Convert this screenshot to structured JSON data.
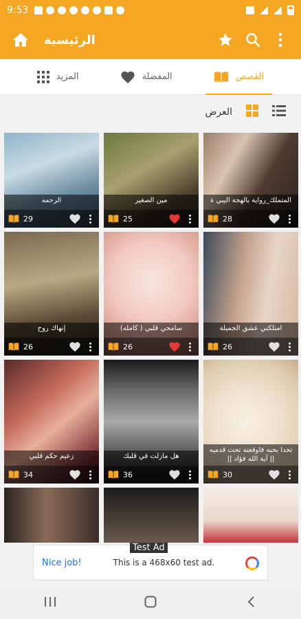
{
  "status": {
    "time": "9:53"
  },
  "toolbar": {
    "title": "الرئيسية"
  },
  "tabs": [
    {
      "label": "المزيد"
    },
    {
      "label": "المفضلة"
    },
    {
      "label": "القصص"
    }
  ],
  "view": {
    "label": "العرض"
  },
  "stories": [
    {
      "title": "الرحمه",
      "count": "29",
      "liked": false
    },
    {
      "title": "مين الصغير",
      "count": "25",
      "liked": true
    },
    {
      "title": "المتملك_رواية بالهجة اليبي ة",
      "count": "28",
      "liked": false
    },
    {
      "title": "إنهاك روح",
      "count": "26",
      "liked": false
    },
    {
      "title": "سامحي قلبي ( كامله)",
      "count": "26",
      "liked": true
    },
    {
      "title": "امتلكني عشق الجميلة",
      "count": "26",
      "liked": false
    },
    {
      "title": "زعيم حكم قلبي",
      "count": "34",
      "liked": false
    },
    {
      "title": "هل مازلت في قلبك",
      "count": "36",
      "liked": false
    },
    {
      "title": "تحدا بحبه فاوقعته تحت قدميه || آية الله فؤاد ||",
      "count": "30",
      "liked": false
    }
  ],
  "ad": {
    "tag": "Test Ad",
    "nice": "Nice job!",
    "text": "This is a 468x60 test ad."
  },
  "colors": {
    "accent": "#f5a623",
    "liked": "#e53935"
  }
}
